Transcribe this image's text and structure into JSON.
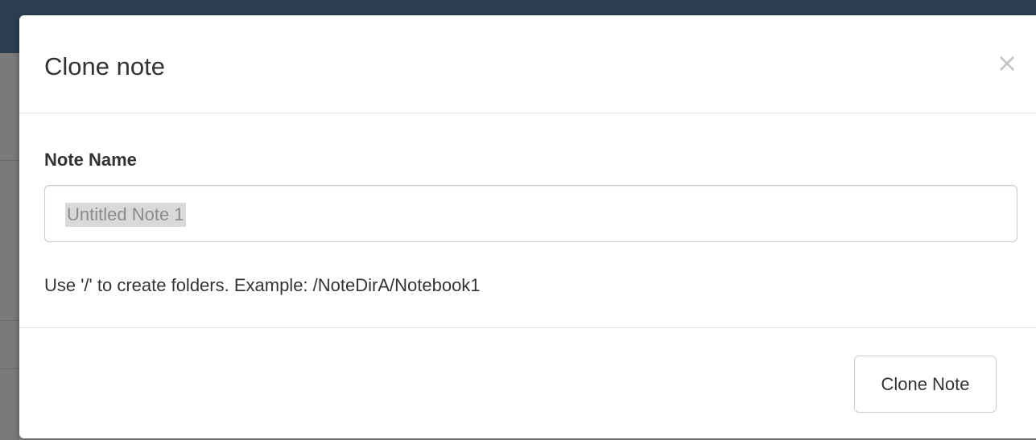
{
  "modal": {
    "title": "Clone note",
    "close_icon": "close-icon",
    "close_glyph": "×"
  },
  "form": {
    "label": "Note Name",
    "input_value": "Untitled Note 1",
    "help_text": "Use '/' to create folders. Example: /NoteDirA/Notebook1"
  },
  "footer": {
    "clone_label": "Clone Note"
  },
  "colors": {
    "topbar": "#2c3e50",
    "overlay": "#8a8a8a",
    "modal_bg": "#ffffff",
    "text": "#333333",
    "selection": "#d9d9d9"
  }
}
